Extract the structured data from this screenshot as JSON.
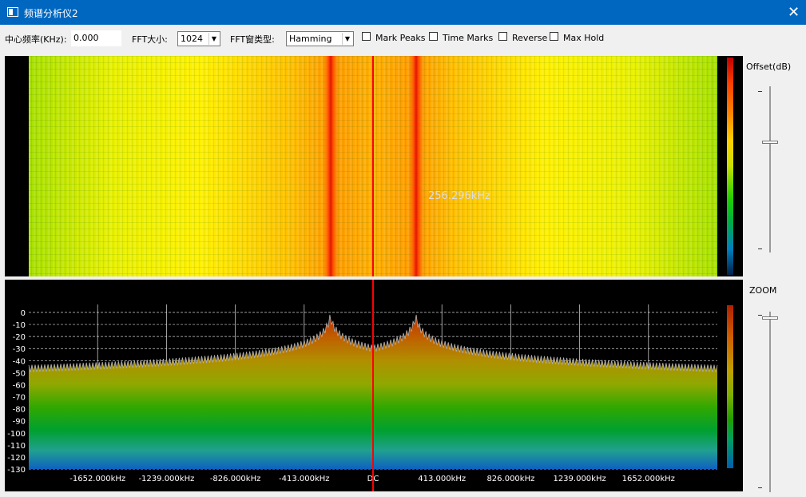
{
  "window": {
    "title": "频谱分析仪2"
  },
  "toolbar": {
    "center_freq_label": "中心频率(KHz):",
    "center_freq_value": "0.000",
    "fft_size_label": "FFT大小:",
    "fft_size_value": "1024",
    "fft_window_label": "FFT窗类型:",
    "fft_window_value": "Hamming",
    "mark_peaks_label": "Mark Peaks",
    "time_marks_label": "Time Marks",
    "reverse_label": "Reverse",
    "max_hold_label": "Max Hold"
  },
  "waterfall": {
    "marker_label": "256.296kHz"
  },
  "side": {
    "offset_label": "Offset(dB)",
    "zoom_label": "ZOOM"
  },
  "colors": {
    "marker": "#ff0000",
    "titlebar": "#0067c0"
  },
  "chart_data": {
    "type": "area",
    "title": "",
    "xlabel": "",
    "ylabel": "",
    "ylim": [
      -130,
      0
    ],
    "y_ticks": [
      0,
      -10,
      -20,
      -30,
      -40,
      -50,
      -60,
      -70,
      -80,
      -90,
      -100,
      -110,
      -120,
      -130
    ],
    "x_tick_labels": [
      "-1652.000kHz",
      "-1239.000kHz",
      "-826.000kHz",
      "-413.000kHz",
      "DC",
      "413.000kHz",
      "826.000kHz",
      "1239.000kHz",
      "1652.000kHz"
    ],
    "x_ticks_khz": [
      -1652,
      -1239,
      -826,
      -413,
      0,
      413,
      826,
      1239,
      1652
    ],
    "xlim_khz": [
      -2065,
      2065
    ],
    "center_marker_khz": 0,
    "peaks": [
      {
        "x_khz": -256.296,
        "y_db": 0
      },
      {
        "x_khz": 256.296,
        "y_db": 0
      }
    ],
    "noise_floor_db": -52,
    "dc_level_db": -30,
    "grid": true
  }
}
